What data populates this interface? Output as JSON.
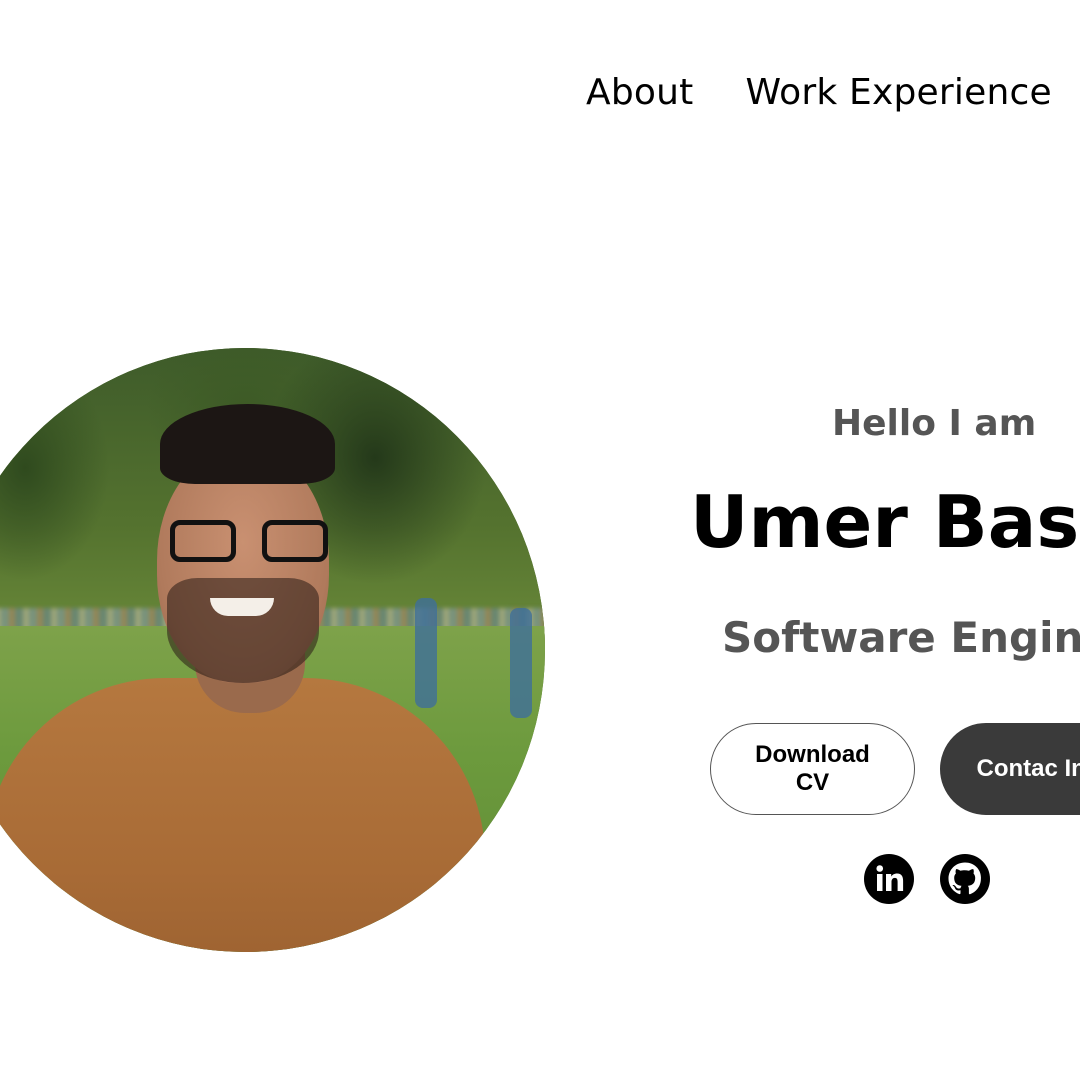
{
  "nav": {
    "items": [
      {
        "label": "About"
      },
      {
        "label": "Work Experience"
      }
    ]
  },
  "profile": {
    "photo_alt": "",
    "greeting": "Hello I am",
    "name": "Umer Bash",
    "title": "Software Engine"
  },
  "buttons": {
    "download_cv": "Download CV",
    "contact_info": "Contac Info"
  },
  "social": {
    "icons": [
      "linkedin-icon",
      "github-icon"
    ]
  },
  "colors": {
    "background": "#ffffff",
    "text_primary": "#000000",
    "text_secondary": "#555555",
    "button_dark": "#3a3a3a"
  }
}
